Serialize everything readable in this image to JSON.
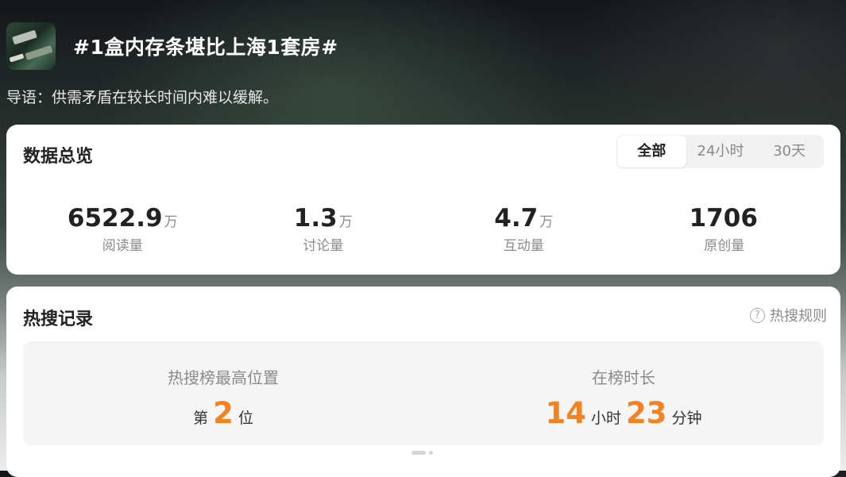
{
  "topic": {
    "title": "#1盒内存条堪比上海1套房#",
    "intro": "导语：供需矛盾在较长时间内难以缓解。"
  },
  "overview": {
    "title": "数据总览",
    "tabs": [
      {
        "label": "全部",
        "active": true
      },
      {
        "label": "24小时",
        "active": false
      },
      {
        "label": "30天",
        "active": false
      }
    ],
    "stats": [
      {
        "value": "6522.9",
        "unit": "万",
        "label": "阅读量"
      },
      {
        "value": "1.3",
        "unit": "万",
        "label": "讨论量"
      },
      {
        "value": "4.7",
        "unit": "万",
        "label": "互动量"
      },
      {
        "value": "1706",
        "unit": "",
        "label": "原创量"
      }
    ]
  },
  "hot": {
    "title": "热搜记录",
    "rules_label": "热搜规则",
    "rules_icon": "question-circle-icon",
    "peak": {
      "label": "热搜榜最高位置",
      "prefix": "第",
      "value": "2",
      "suffix": "位"
    },
    "duration": {
      "label": "在榜时长",
      "hours": "14",
      "hours_unit": "小时",
      "minutes": "23",
      "minutes_unit": "分钟"
    }
  },
  "colors": {
    "accent": "#f58220",
    "muted": "#8a8a8a",
    "text": "#222222"
  }
}
